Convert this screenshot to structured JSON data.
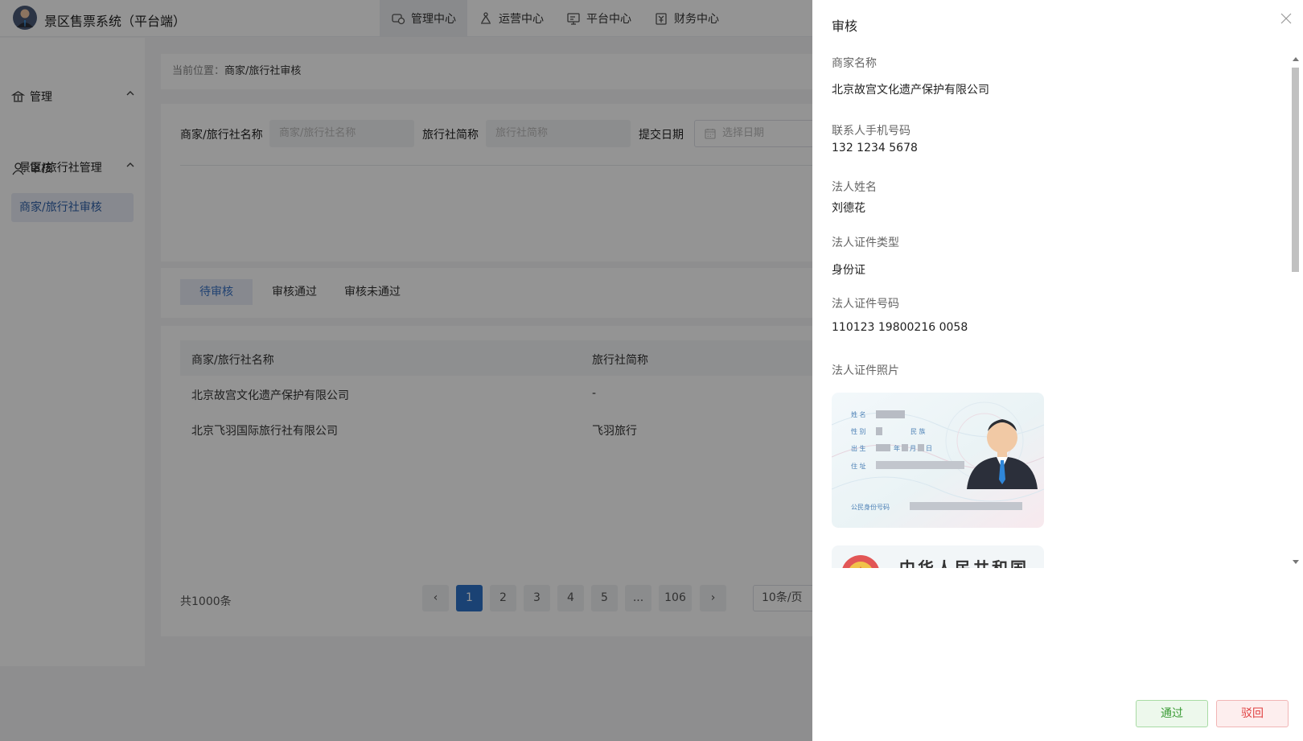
{
  "app": {
    "title": "景区售票系统（平台端）"
  },
  "nav": [
    {
      "label": "管理中心",
      "icon": "management-icon",
      "active": true
    },
    {
      "label": "运营中心",
      "icon": "operations-icon",
      "active": false
    },
    {
      "label": "平台中心",
      "icon": "platform-icon",
      "active": false
    },
    {
      "label": "财务中心",
      "icon": "finance-icon",
      "active": false
    }
  ],
  "sidebar": {
    "groups": [
      {
        "label": "管理",
        "icon": "bank-icon",
        "items": [
          {
            "label": "景区/旅行社管理",
            "active": false
          }
        ]
      },
      {
        "label": "审核",
        "icon": "user-icon",
        "items": [
          {
            "label": "商家/旅行社审核",
            "active": true
          }
        ]
      }
    ]
  },
  "breadcrumb": {
    "prefix": "当前位置：",
    "current": "商家/旅行社审核"
  },
  "filter": {
    "name_label": "商家/旅行社名称",
    "name_placeholder": "商家/旅行社名称",
    "short_label": "旅行社简称",
    "short_placeholder": "旅行社简称",
    "date_label": "提交日期",
    "date_placeholder": "选择日期"
  },
  "tabs": [
    {
      "label": "待审核",
      "active": true
    },
    {
      "label": "审核通过",
      "active": false
    },
    {
      "label": "审核未通过",
      "active": false
    }
  ],
  "table": {
    "headers": [
      "商家/旅行社名称",
      "旅行社简称"
    ],
    "rows": [
      [
        "北京故宫文化遗产保护有限公司",
        "-"
      ],
      [
        "北京飞羽国际旅行社有限公司",
        "飞羽旅行"
      ]
    ]
  },
  "pagination": {
    "total": "共1000条",
    "prev": "‹",
    "next": "›",
    "pages": [
      "1",
      "2",
      "3",
      "4",
      "5",
      "...",
      "106"
    ],
    "current": "1",
    "page_size": "10条/页"
  },
  "drawer": {
    "title": "审核",
    "fields": [
      {
        "label": "商家名称",
        "value": "北京故宫文化遗产保护有限公司"
      },
      {
        "label": "联系人手机号码",
        "value": "132 1234 5678"
      },
      {
        "label": "法人姓名",
        "value": "刘德花"
      },
      {
        "label": "法人证件类型",
        "value": "身份证"
      },
      {
        "label": "法人证件号码",
        "value": "110123 19800216 0058"
      }
    ],
    "photo_label": "法人证件照片",
    "id_front": {
      "name_label": "姓 名",
      "gender_label": "性 别",
      "ethnicity_label": "民 族",
      "birth_label": "出 生",
      "birth_year": "年",
      "birth_month": "月",
      "birth_day": "日",
      "address_label": "住 址",
      "id_number_label": "公民身份号码"
    },
    "id_back_title": "中华人民共和国",
    "approve_label": "通过",
    "reject_label": "驳回"
  },
  "colors": {
    "primary": "#2e73c9",
    "approve": "#3a9b35",
    "reject": "#e04040"
  }
}
